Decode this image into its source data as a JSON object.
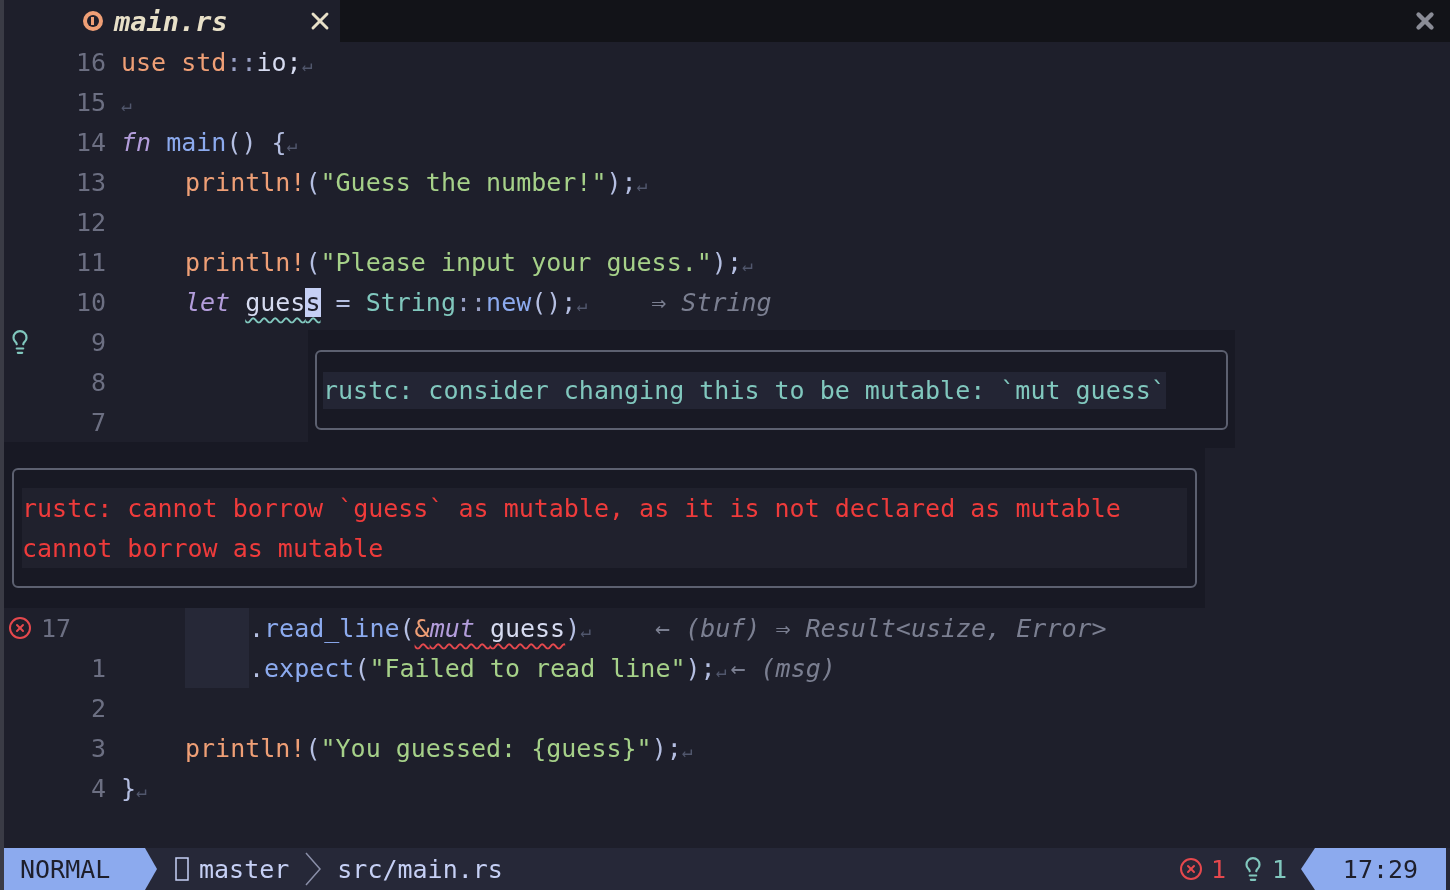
{
  "tab": {
    "filename": "main.rs"
  },
  "code_top": [
    {
      "number": "16",
      "tokens": [
        {
          "text": "use ",
          "kind": "keyword"
        },
        {
          "text": "std",
          "kind": "keyword"
        },
        {
          "text": "::",
          "kind": "sep"
        },
        {
          "text": "io;",
          "kind": "plain"
        },
        {
          "text": "↵",
          "kind": "eol"
        }
      ]
    },
    {
      "number": "15",
      "tokens": [
        {
          "text": "↵",
          "kind": "eol"
        }
      ]
    },
    {
      "number": "14",
      "tokens": [
        {
          "text": "fn ",
          "kind": "italic"
        },
        {
          "text": "main",
          "kind": "function"
        },
        {
          "text": "() {",
          "kind": "punct"
        },
        {
          "text": "↵",
          "kind": "eol"
        }
      ]
    },
    {
      "number": "13",
      "indented": true,
      "tokens": [
        {
          "text": "println!",
          "kind": "macro"
        },
        {
          "text": "(",
          "kind": "punct"
        },
        {
          "text": "\"Guess the number!\"",
          "kind": "string"
        },
        {
          "text": ");",
          "kind": "punct"
        },
        {
          "text": "↵",
          "kind": "eol"
        }
      ]
    },
    {
      "number": "12"
    },
    {
      "number": "11",
      "indented": true,
      "tokens": [
        {
          "text": "println!",
          "kind": "macro"
        },
        {
          "text": "(",
          "kind": "punct"
        },
        {
          "text": "\"Please input your guess.\"",
          "kind": "string"
        },
        {
          "text": ");",
          "kind": "punct"
        },
        {
          "text": "↵",
          "kind": "eol"
        }
      ]
    },
    {
      "number": "10",
      "indented": true,
      "tokens": [
        {
          "text": "let ",
          "kind": "italic"
        },
        {
          "text": "gues",
          "kind": "plain",
          "hint_underline": true
        },
        {
          "text": "s",
          "kind": "cursor",
          "hint_underline": true
        },
        {
          "text": " = ",
          "kind": "punct"
        },
        {
          "text": "String",
          "kind": "type"
        },
        {
          "text": "::",
          "kind": "sep"
        },
        {
          "text": "new",
          "kind": "function"
        },
        {
          "text": "();",
          "kind": "punct"
        },
        {
          "text": "↵",
          "kind": "eol"
        }
      ],
      "hint": {
        "text": "⇒ String",
        "gap": true
      }
    },
    {
      "number": "9",
      "lightbulb": true
    },
    {
      "number": "8"
    },
    {
      "number": "7"
    }
  ],
  "hint_popup": {
    "text": "rustc: consider changing this to be mutable: `mut guess`"
  },
  "error_popup": {
    "lines": [
      "rustc: cannot borrow `guess` as mutable, as it is not declared as mutable",
      "cannot borrow as mutable"
    ]
  },
  "code_bottom": [
    {
      "number": "17",
      "error": true,
      "current": true,
      "indented": true,
      "guide": true,
      "tokens": [
        {
          "text": ".",
          "kind": "punct"
        },
        {
          "text": "read_line",
          "kind": "function"
        },
        {
          "text": "(",
          "kind": "punct"
        },
        {
          "text": "&",
          "kind": "keyword",
          "error_underline": true
        },
        {
          "text": "mut ",
          "kind": "italic",
          "error_underline": true
        },
        {
          "text": "guess",
          "kind": "plain",
          "error_underline": true
        },
        {
          "text": ")",
          "kind": "punct"
        },
        {
          "text": "↵",
          "kind": "eol"
        }
      ],
      "hint": {
        "text": "← (buf) ⇒ Result<usize, Error>",
        "gap": true
      }
    },
    {
      "number": "1",
      "indented": true,
      "guide": true,
      "tokens": [
        {
          "text": ".",
          "kind": "punct"
        },
        {
          "text": "expect",
          "kind": "function"
        },
        {
          "text": "(",
          "kind": "punct"
        },
        {
          "text": "\"Failed to read line\"",
          "kind": "string"
        },
        {
          "text": ");",
          "kind": "punct"
        },
        {
          "text": "↵",
          "kind": "eol"
        }
      ],
      "hint": {
        "text": "← (msg)",
        "gap": false
      }
    },
    {
      "number": "2"
    },
    {
      "number": "3",
      "indented": true,
      "tokens": [
        {
          "text": "println!",
          "kind": "macro"
        },
        {
          "text": "(",
          "kind": "punct"
        },
        {
          "text": "\"You guessed: {guess}\"",
          "kind": "string"
        },
        {
          "text": ");",
          "kind": "punct"
        },
        {
          "text": "↵",
          "kind": "eol"
        }
      ]
    },
    {
      "number": "4",
      "tokens": [
        {
          "text": "}",
          "kind": "punct"
        },
        {
          "text": "↵",
          "kind": "eol"
        }
      ]
    }
  ],
  "status_bar": {
    "mode": "NORMAL",
    "branch": "master",
    "file": "src/main.rs",
    "errors": "1",
    "hints": "1",
    "time": "17:29"
  }
}
